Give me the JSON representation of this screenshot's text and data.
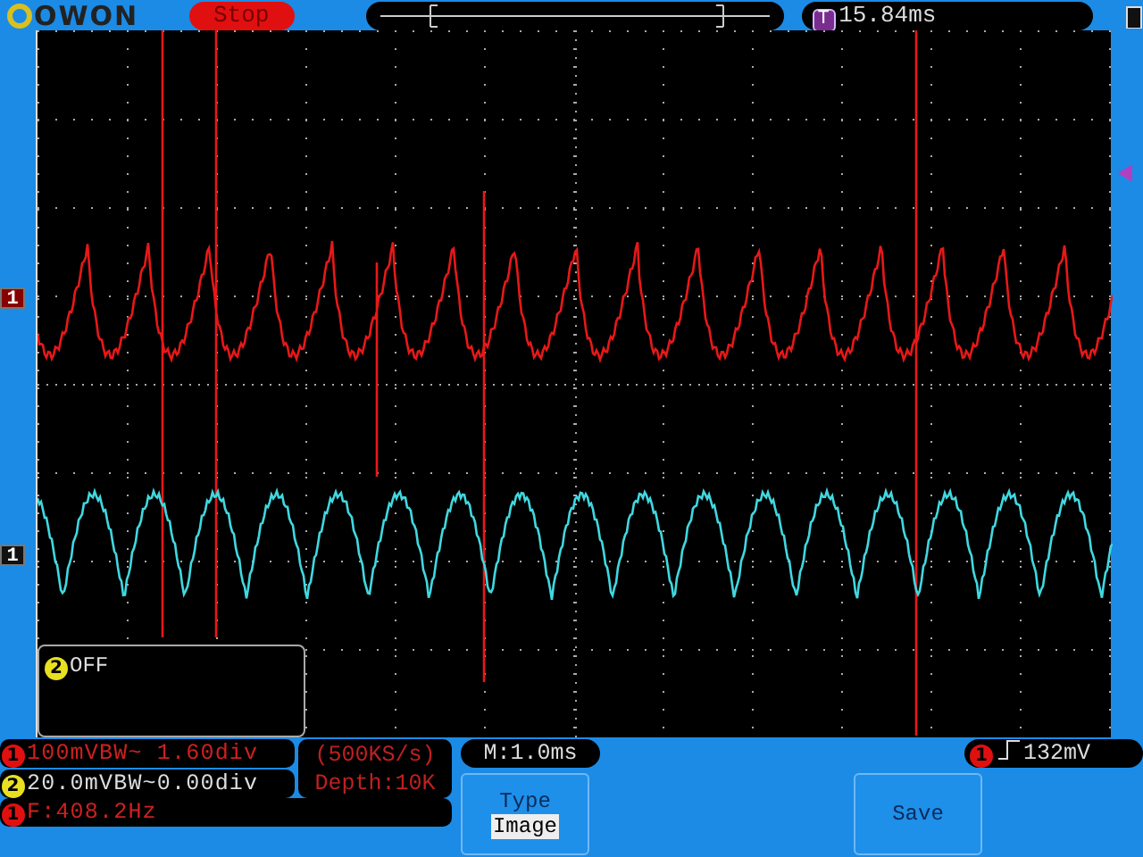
{
  "header": {
    "logo": "OWON",
    "run_state": "Stop",
    "trigger_marker": "T",
    "trigger_time": "15.84ms"
  },
  "markers": [
    {
      "label": "1",
      "kind": "ch1"
    },
    {
      "label": "1",
      "kind": "ch2"
    }
  ],
  "overlay": {
    "badge": "2",
    "text": "OFF"
  },
  "channels": [
    {
      "badge": "1",
      "kind": "ch1",
      "text": "100mVBW~ 1.60div"
    },
    {
      "badge": "2",
      "kind": "ch2",
      "text": "20.0mVBW~0.00div"
    }
  ],
  "sampling": {
    "rate": "(500KS/s)",
    "depth": "Depth:10K"
  },
  "frequency": {
    "badge": "1",
    "text": "F:408.2Hz"
  },
  "timebase": "M:1.0ms",
  "trigger": {
    "badge": "1",
    "level": "132mV"
  },
  "menu": [
    {
      "kind": "option",
      "label": "Type",
      "value": "Image"
    },
    {
      "kind": "action",
      "label": "Save"
    }
  ]
}
